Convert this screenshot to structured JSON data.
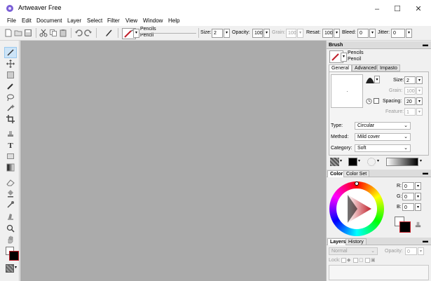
{
  "window": {
    "title": "Artweaver Free",
    "min": "–",
    "max": "☐",
    "close": "✕"
  },
  "menu": [
    "File",
    "Edit",
    "Document",
    "Layer",
    "Select",
    "Filter",
    "View",
    "Window",
    "Help"
  ],
  "toolbar": {
    "preset_category": "Pencils",
    "preset_name": "Pencil",
    "size_label": "Size:",
    "size_value": "2",
    "opacity_label": "Opacity:",
    "opacity_value": "100",
    "grain_label": "Grain:",
    "grain_value": "100",
    "resat_label": "Resat:",
    "resat_value": "100",
    "bleed_label": "Bleed:",
    "bleed_value": "0",
    "jitter_label": "Jitter:",
    "jitter_value": "0"
  },
  "brush_panel": {
    "title": "Brush",
    "category": "Pencils",
    "name": "Pencil",
    "tabs": [
      "General",
      "Advanced",
      "Impasto"
    ],
    "size_label": "Size:",
    "size_value": "2",
    "grain_label": "Grain:",
    "grain_value": "100",
    "spacing_label": "Spacing:",
    "spacing_value": "20",
    "feature_label": "Feature:",
    "feature_value": "1",
    "type_label": "Type:",
    "type_value": "Circular",
    "method_label": "Method:",
    "method_value": "Mild cover",
    "category_label": "Category:",
    "category_value": "Soft"
  },
  "color_panel": {
    "tabs": [
      "Color",
      "Color Set"
    ],
    "r_label": "R:",
    "r_value": "0",
    "g_label": "G:",
    "g_value": "0",
    "b_label": "B:",
    "b_value": "0"
  },
  "layers_panel": {
    "tabs": [
      "Layers",
      "History"
    ],
    "blend_mode": "Normal",
    "opacity_label": "Opacity:",
    "opacity_value": "0",
    "lock_label": "Lock:"
  },
  "colors": {
    "canvas": "#ababab",
    "foreground": "#000000",
    "background": "#ffffff",
    "accent_red": "#c0202a"
  }
}
